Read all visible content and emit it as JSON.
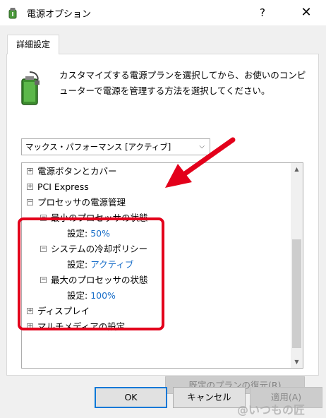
{
  "window": {
    "title": "電源オプション",
    "help_label": "?",
    "close_label": "✕"
  },
  "tab": {
    "label": "詳細設定"
  },
  "description": "カスタマイズする電源プランを選択してから、お使いのコンピューターで電源を管理する方法を選択してください。",
  "plan_select": {
    "value": "マックス・パフォーマンス [アクティブ]"
  },
  "tree": {
    "items": [
      {
        "label": "電源ボタンとカバー",
        "expander": "+"
      },
      {
        "label": "PCI Express",
        "expander": "+"
      },
      {
        "label": "プロセッサの電源管理",
        "expander": "−"
      },
      {
        "label": "最小のプロセッサの状態",
        "expander": "−"
      },
      {
        "setting_label": "設定:",
        "setting_value": "50%"
      },
      {
        "label": "システムの冷却ポリシー",
        "expander": "−"
      },
      {
        "setting_label": "設定:",
        "setting_value": "アクティブ"
      },
      {
        "label": "最大のプロセッサの状態",
        "expander": "−"
      },
      {
        "setting_label": "設定:",
        "setting_value": "100%"
      },
      {
        "label": "ディスプレイ",
        "expander": "+"
      },
      {
        "label": "マルチメディアの設定",
        "expander": "+"
      }
    ]
  },
  "buttons": {
    "restore": "既定のプランの復元(R)",
    "ok": "OK",
    "cancel": "キャンセル",
    "apply": "適用(A)"
  },
  "watermark": "@いつもの匠",
  "colors": {
    "highlight": "#e3001b",
    "setting_value": "#1a6fc9",
    "focus": "#0078d7"
  }
}
